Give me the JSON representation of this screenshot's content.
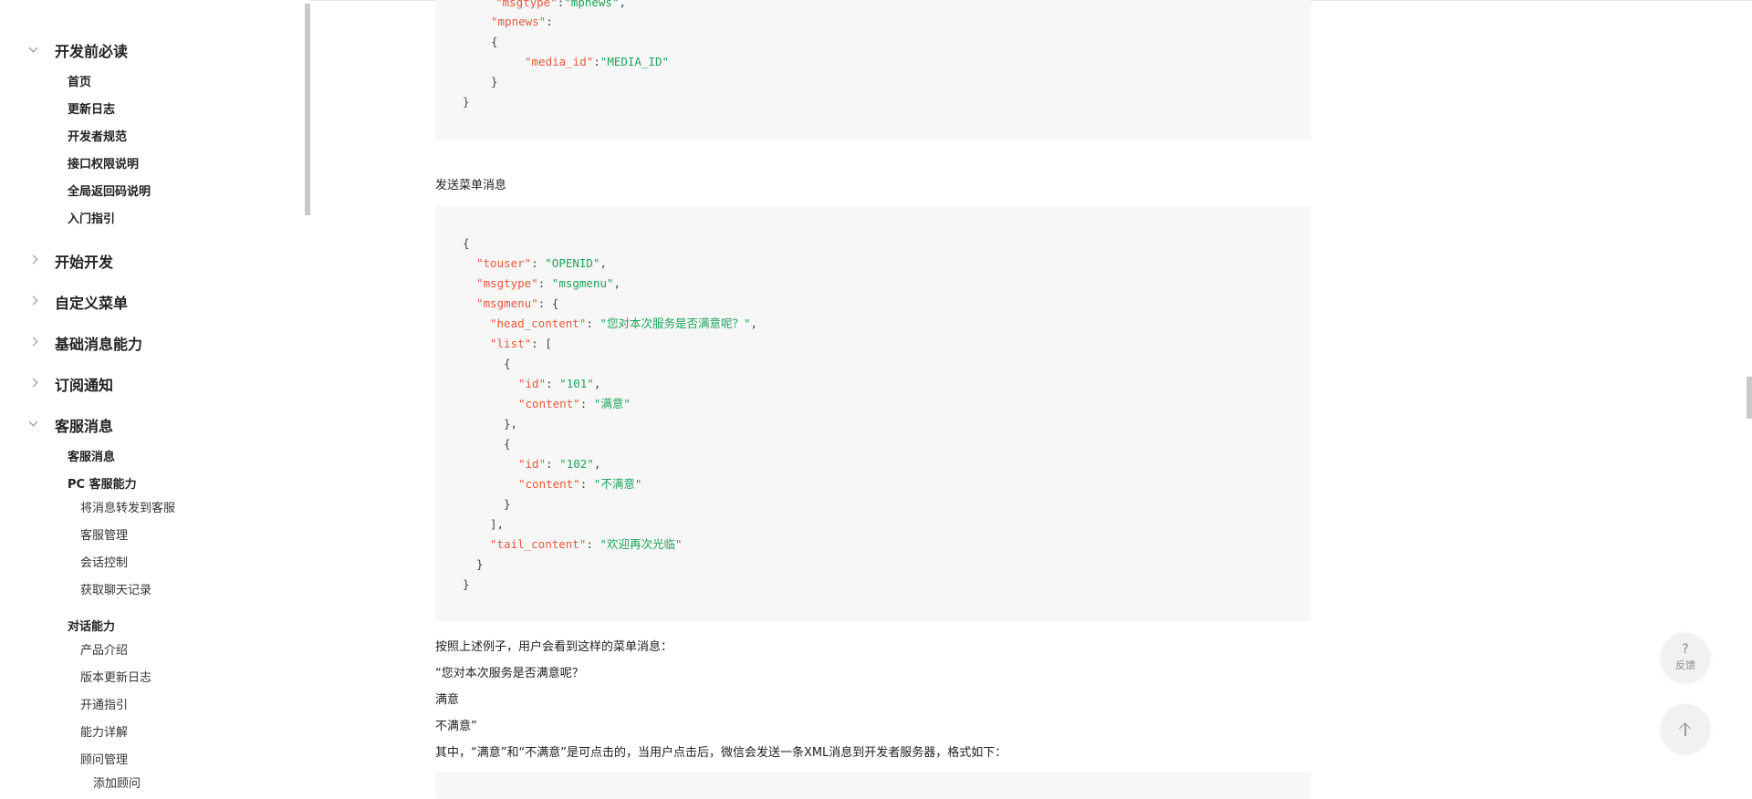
{
  "sidebar": {
    "groups": [
      {
        "title": "开发前必读",
        "expanded": true
      },
      {
        "title": "开始开发",
        "expanded": false
      },
      {
        "title": "自定义菜单",
        "expanded": false
      },
      {
        "title": "基础消息能力",
        "expanded": false
      },
      {
        "title": "订阅通知",
        "expanded": false
      },
      {
        "title": "客服消息",
        "expanded": true
      }
    ],
    "dev_prereq_items": [
      "首页",
      "更新日志",
      "开发者规范",
      "接口权限说明",
      "全局返回码说明",
      "入门指引"
    ],
    "kf_items": {
      "kf": "客服消息",
      "pc": "PC 客服能力",
      "pc_children": [
        "将消息转发到客服",
        "客服管理",
        "会话控制",
        "获取聊天记录"
      ],
      "dialog": "对话能力",
      "dialog_children": [
        "产品介绍",
        "版本更新日志",
        "开通指引",
        "能力详解",
        "顾问管理"
      ],
      "advisor_children": [
        "添加顾问"
      ]
    }
  },
  "content": {
    "code1": {
      "line0_key": "\"msgtype\"",
      "line0_val": "\"mpnews\"",
      "line1_key": "\"mpnews\"",
      "line3_key": "\"media_id\"",
      "line3_val": "\"MEDIA_ID\""
    },
    "menu_heading": "发送菜单消息",
    "code2": {
      "touser_key": "\"touser\"",
      "touser_val": "\"OPENID\"",
      "msgtype_key": "\"msgtype\"",
      "msgtype_val": "\"msgmenu\"",
      "msgmenu_key": "\"msgmenu\"",
      "head_key": "\"head_content\"",
      "head_val": "\"您对本次服务是否满意呢？\"",
      "list_key": "\"list\"",
      "id_key": "\"id\"",
      "id1_val": "\"101\"",
      "id2_val": "\"102\"",
      "content_key": "\"content\"",
      "content1_val": "\"满意\"",
      "content2_val": "\"不满意\"",
      "tail_key": "\"tail_content\"",
      "tail_val": "\"欢迎再次光临\""
    },
    "paras": [
      "按照上述例子，用户会看到这样的菜单消息：",
      "“您对本次服务是否满意呢？",
      "满意",
      "不满意”",
      "其中，“满意”和“不满意”是可点击的，当用户点击后，微信会发送一条XML消息到开发者服务器，格式如下："
    ]
  },
  "floating": {
    "feedback_symbol": "?",
    "feedback_label": "反馈"
  }
}
